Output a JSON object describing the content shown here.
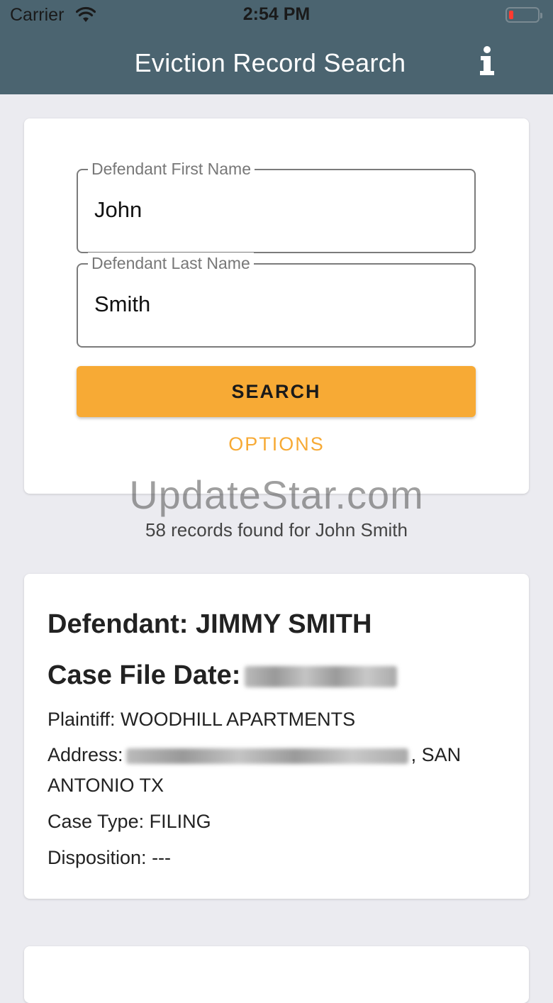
{
  "status_bar": {
    "carrier": "Carrier",
    "time": "2:54 PM",
    "battery_level": 0.15,
    "battery_color": "#ff3b30"
  },
  "nav": {
    "title": "Eviction Record Search",
    "info_icon": "info-icon",
    "bar_color": "#4b6470"
  },
  "search_form": {
    "first_name_label": "Defendant First Name",
    "first_name_value": "John",
    "last_name_label": "Defendant Last Name",
    "last_name_value": "Smith",
    "search_label": "SEARCH",
    "options_label": "OPTIONS",
    "accent_color": "#f7aa35"
  },
  "watermark": "UpdateStar.com",
  "results": {
    "summary": "58 records found for John Smith",
    "items": [
      {
        "defendant": "Defendant: JIMMY SMITH",
        "case_file_date_label": "Case File Date:",
        "plaintiff": "Plaintiff: WOODHILL APARTMENTS",
        "address_label": "Address:",
        "address_suffix": ", SAN ANTONIO TX",
        "case_type": "Case Type: FILING",
        "disposition": "Disposition: ---"
      }
    ]
  }
}
